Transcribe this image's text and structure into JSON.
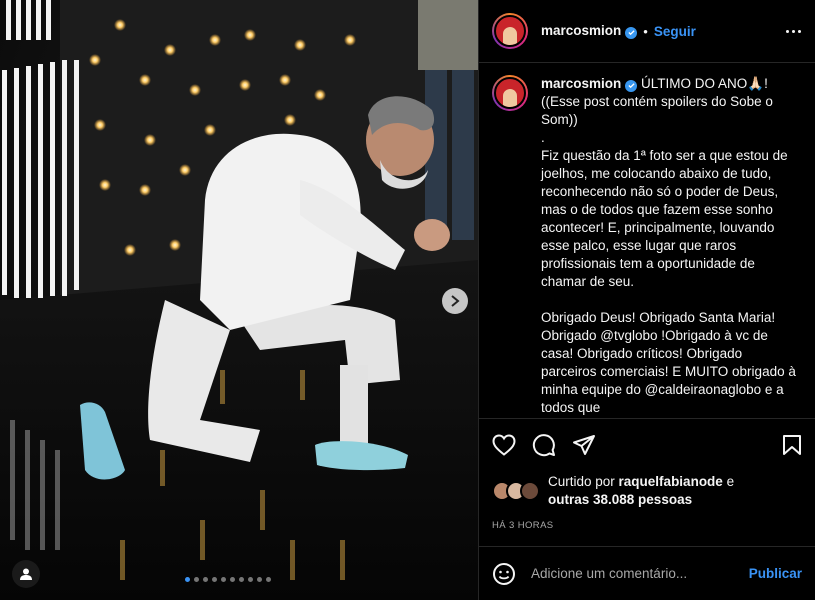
{
  "header": {
    "username": "marcosmion",
    "separator": "•",
    "follow_label": "Seguir",
    "more_icon": "more-options-icon"
  },
  "post": {
    "username": "marcosmion",
    "caption": " ÚLTIMO DO ANO🙏🏻!\n((Esse post contém spoilers do Sobe o Som))\n.\nFiz questão da 1ª foto ser a que estou de joelhos, me colocando abaixo de tudo, reconhecendo não só o poder de Deus, mas o de todos que fazem esse sonho acontecer! E, principalmente, louvando esse palco, esse lugar que raros profissionais tem a oportunidade de chamar de seu.\n\nObrigado Deus! Obrigado Santa Maria! Obrigado @tvglobo !Obrigado à vc de casa! Obrigado críticos! Obrigado parceiros comerciais! E MUITO obrigado à minha equipe do @caldeiraonaglobo e a todos que"
  },
  "actions": {
    "like_icon": "heart-icon",
    "comment_icon": "comment-icon",
    "share_icon": "share-icon",
    "save_icon": "bookmark-icon"
  },
  "likes": {
    "prefix": "Curtido por ",
    "user": "raquelfabianode",
    "middle": " e ",
    "others": "outras 38.088 pessoas"
  },
  "timestamp": "HÁ 3 HORAS",
  "comment_box": {
    "emoji_icon": "emoji-icon",
    "placeholder": "Adicione um comentário...",
    "publish_label": "Publicar"
  },
  "carousel": {
    "total_slides": 10,
    "active_index": 0
  },
  "colors": {
    "accent": "#3a93f5",
    "background": "#000000",
    "text": "#f5f5f5",
    "muted": "#a8a8a8",
    "border": "#262626"
  }
}
